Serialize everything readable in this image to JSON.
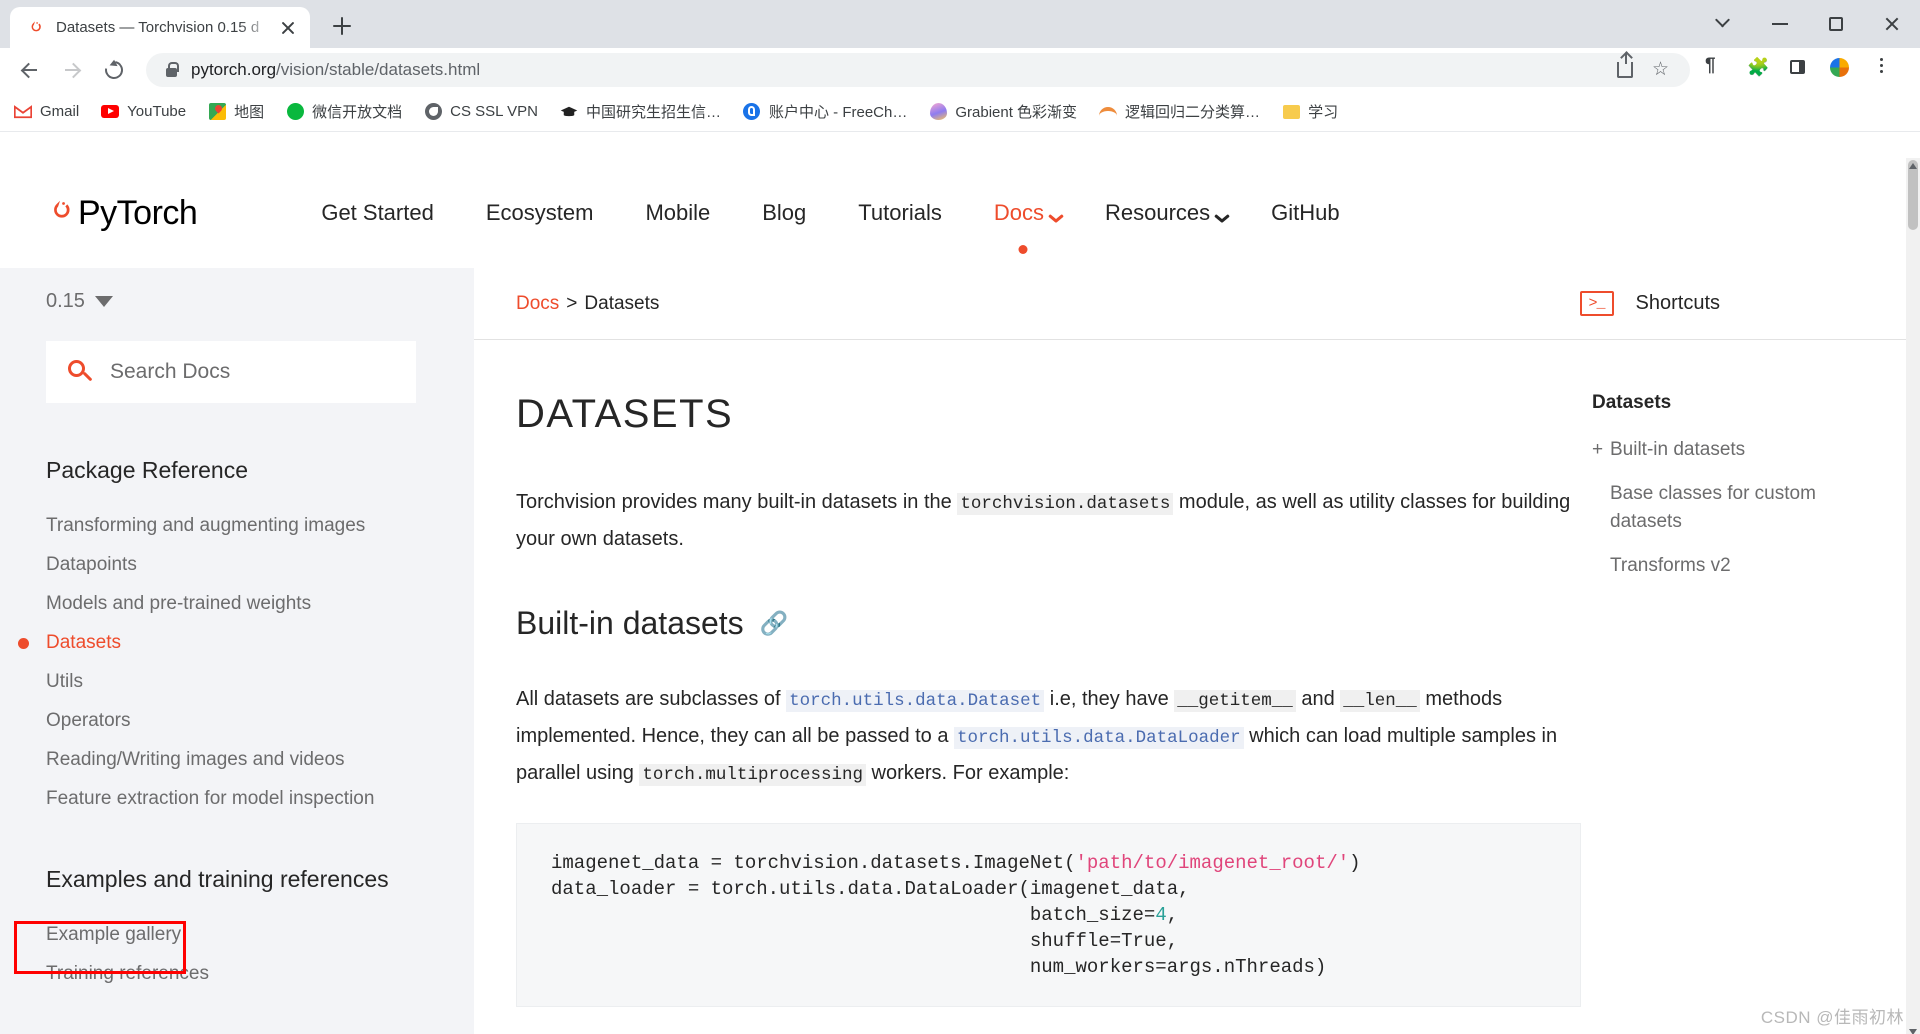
{
  "browser": {
    "tab": {
      "title": "Datasets — Torchvision 0.15 d",
      "favicon": "pytorch-flame-icon"
    },
    "newtab_label": "+",
    "window_controls": [
      "chevron-down-icon",
      "minimize-icon",
      "maximize-icon",
      "close-icon"
    ],
    "toolbar": {
      "back": "back-arrow-icon",
      "forward": "forward-arrow-icon",
      "reload": "reload-icon",
      "url": "pytorch.org/vision/stable/datasets.html",
      "url_host": "pytorch.org",
      "url_path": "/vision/stable/datasets.html",
      "lock": "lock-icon",
      "right_icons": [
        "share-icon",
        "star-icon",
        "translate-icon",
        "extensions-icon",
        "side-panel-icon",
        "profile-avatar-icon",
        "menu-kebab-icon"
      ]
    },
    "bookmarks": [
      {
        "label": "Gmail",
        "icon": "M",
        "color": "#ea4335"
      },
      {
        "label": "YouTube",
        "icon": "▶",
        "color": "#ff0000"
      },
      {
        "label": "地图",
        "icon": "📍",
        "color": "#34a853"
      },
      {
        "label": "微信开放文档",
        "icon": "●",
        "color": "#09b83e"
      },
      {
        "label": "CS SSL VPN",
        "icon": "◕",
        "color": "#5f6368"
      },
      {
        "label": "中国研究生招生信…",
        "icon": "🎓",
        "color": "#222222"
      },
      {
        "label": "账户中心 - FreeCh…",
        "icon": "◉",
        "color": "#1a73e8"
      },
      {
        "label": "Grabient 色彩渐变",
        "icon": "◍",
        "color": "#c471ed"
      },
      {
        "label": "逻辑回归二分类算…",
        "icon": "◠",
        "color": "#ee8c3c"
      },
      {
        "label": "学习",
        "icon": "▯",
        "color": "#f5c542"
      }
    ]
  },
  "site": {
    "logo_text": "PyTorch",
    "nav": [
      {
        "label": "Get Started",
        "active": false,
        "caret": false
      },
      {
        "label": "Ecosystem",
        "active": false,
        "caret": false
      },
      {
        "label": "Mobile",
        "active": false,
        "caret": false
      },
      {
        "label": "Blog",
        "active": false,
        "caret": false
      },
      {
        "label": "Tutorials",
        "active": false,
        "caret": false
      },
      {
        "label": "Docs",
        "active": true,
        "caret": true
      },
      {
        "label": "Resources",
        "active": false,
        "caret": true
      },
      {
        "label": "GitHub",
        "active": false,
        "caret": false
      }
    ]
  },
  "sidebar": {
    "version": "0.15",
    "search_placeholder": "Search Docs",
    "section1_title": "Package Reference",
    "items": [
      {
        "label": "Transforming and augmenting images",
        "active": false
      },
      {
        "label": "Datapoints",
        "active": false
      },
      {
        "label": "Models and pre-trained weights",
        "active": false
      },
      {
        "label": "Datasets",
        "active": true
      },
      {
        "label": "Utils",
        "active": false
      },
      {
        "label": "Operators",
        "active": false
      },
      {
        "label": "Reading/Writing images and videos",
        "active": false
      },
      {
        "label": "Feature extraction for model inspection",
        "active": false
      }
    ],
    "section2_title": "Examples and training references",
    "items2": [
      {
        "label": "Example gallery",
        "active": false
      },
      {
        "label": "Training references",
        "active": false
      }
    ]
  },
  "main": {
    "breadcrumb_root": "Docs",
    "breadcrumb_sep": ">",
    "breadcrumb_current": "Datasets",
    "shortcuts_label": "Shortcuts",
    "shortcuts_icon": "terminal-icon",
    "title": "DATASETS",
    "intro": {
      "p1_a": "Torchvision provides many built-in datasets in the ",
      "p1_code": "torchvision.datasets",
      "p1_b": " module, as well as utility classes for building your own datasets."
    },
    "section": {
      "heading": "Built-in datasets",
      "anchor_icon": "link-icon",
      "p_a": "All datasets are subclasses of ",
      "p_code1": "torch.utils.data.Dataset",
      "p_b": " i.e, they have ",
      "p_code2": "__getitem__",
      "p_c": " and ",
      "p_code3": "__len__",
      "p_d": " methods implemented. Hence, they can all be passed to a ",
      "p_code4": "torch.utils.data.DataLoader",
      "p_e": " which can load multiple samples in parallel using ",
      "p_code5": "torch.multiprocessing",
      "p_f": " workers. For example:"
    },
    "code": {
      "line1_a": "imagenet_data = torchvision.datasets.ImageNet(",
      "line1_str": "'path/to/imagenet_root/'",
      "line1_b": ")",
      "line2": "data_loader = torch.utils.data.DataLoader(imagenet_data,",
      "line3_a": "                                          batch_size=",
      "line3_num": "4",
      "line3_b": ",",
      "line4": "                                          shuffle=True,",
      "line5": "                                          num_workers=args.nThreads)"
    }
  },
  "toc": {
    "heading": "Datasets",
    "items": [
      {
        "label": "Built-in datasets",
        "expandable": true,
        "marker": "+"
      },
      {
        "label": "Base classes for custom datasets",
        "expandable": false,
        "marker": ""
      },
      {
        "label": "Transforms v2",
        "expandable": false,
        "marker": ""
      }
    ]
  },
  "watermark": "CSDN @佳雨初林",
  "colors": {
    "accent": "#ee4c2c",
    "annotation": "#ff0000",
    "sidebar_bg": "#f3f4f7",
    "code_bg": "#f6f7f8"
  }
}
